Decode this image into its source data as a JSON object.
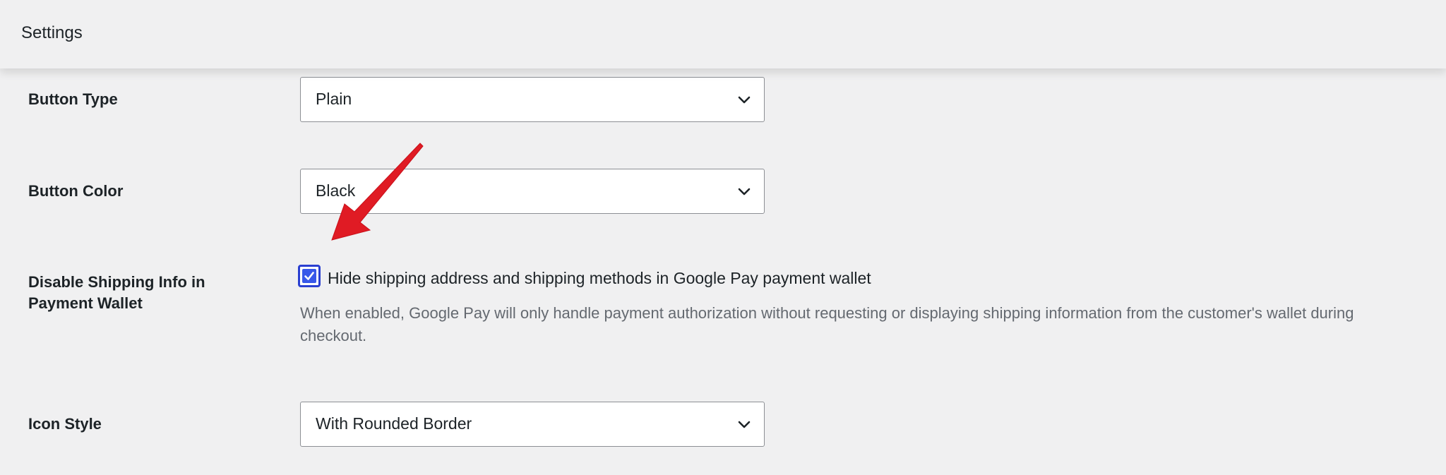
{
  "header": {
    "title": "Settings"
  },
  "fields": {
    "button_type": {
      "label": "Button Type",
      "value": "Plain"
    },
    "button_color": {
      "label": "Button Color",
      "value": "Black"
    },
    "disable_shipping": {
      "label_line1": "Disable Shipping Info in",
      "label_line2": "Payment Wallet",
      "checkbox_label": "Hide shipping address and shipping methods in Google Pay payment wallet",
      "checked": true,
      "description": "When enabled, Google Pay will only handle payment authorization without requesting or displaying shipping information from the customer's wallet during checkout."
    },
    "icon_style": {
      "label": "Icon Style",
      "value": "With Rounded Border"
    }
  },
  "icons": {
    "select_indicator": "chevron-down-icon",
    "checkbox_mark": "checkmark-icon",
    "annotation": "red-arrow-icon"
  },
  "colors": {
    "accent": "#3858e9",
    "arrow": "#e01b24",
    "background": "#f0f0f1"
  }
}
